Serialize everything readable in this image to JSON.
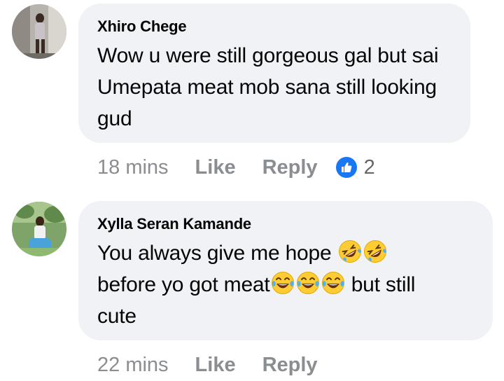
{
  "comments": [
    {
      "author": "Xhiro Chege",
      "text": "Wow u were still gorgeous gal but sai Umepata meat mob sana still looking gud",
      "time": "18 mins",
      "like_label": "Like",
      "reply_label": "Reply",
      "reaction_count": "2",
      "reaction_icon": "like-thumb"
    },
    {
      "author": "Xylla Seran Kamande",
      "text_line1": "You always give me hope",
      "text_line2": "before yo got meat",
      "text_line2_tail": " but still",
      "text_line3": "cute",
      "emojis_line1": [
        "rolling-on-floor-laughing",
        "rolling-on-floor-laughing"
      ],
      "emojis_line2": [
        "tears-of-joy",
        "tears-of-joy",
        "tears-of-joy"
      ],
      "time": "22 mins",
      "like_label": "Like",
      "reply_label": "Reply"
    }
  ],
  "colors": {
    "bubble": "#f0f2f5",
    "meta_text": "#8a8d91",
    "like_blue": "#1877f2",
    "emoji_yellow": "#ffcc33"
  }
}
